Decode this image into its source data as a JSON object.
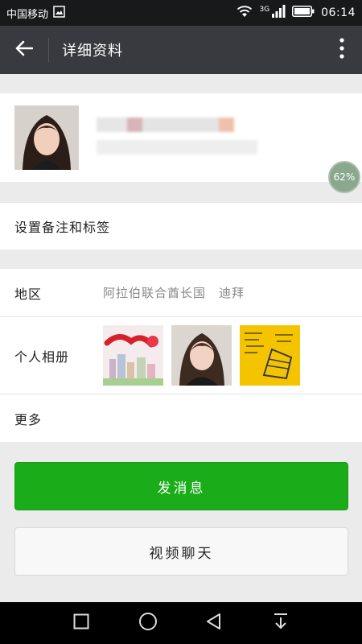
{
  "status_bar": {
    "carrier": "中国移动",
    "network": "3G",
    "time": "06:14"
  },
  "header": {
    "title": "详细资料"
  },
  "profile": {
    "progress_badge": "62%"
  },
  "remark": {
    "label": "设置备注和标签"
  },
  "info": {
    "region_label": "地区",
    "region_value": "阿拉伯联合酋长国　迪拜",
    "album_label": "个人相册",
    "more_label": "更多"
  },
  "actions": {
    "send_message": "发消息",
    "video_chat": "视频聊天"
  },
  "colors": {
    "primary_green": "#1aad19",
    "header_bg": "#393a3f"
  }
}
